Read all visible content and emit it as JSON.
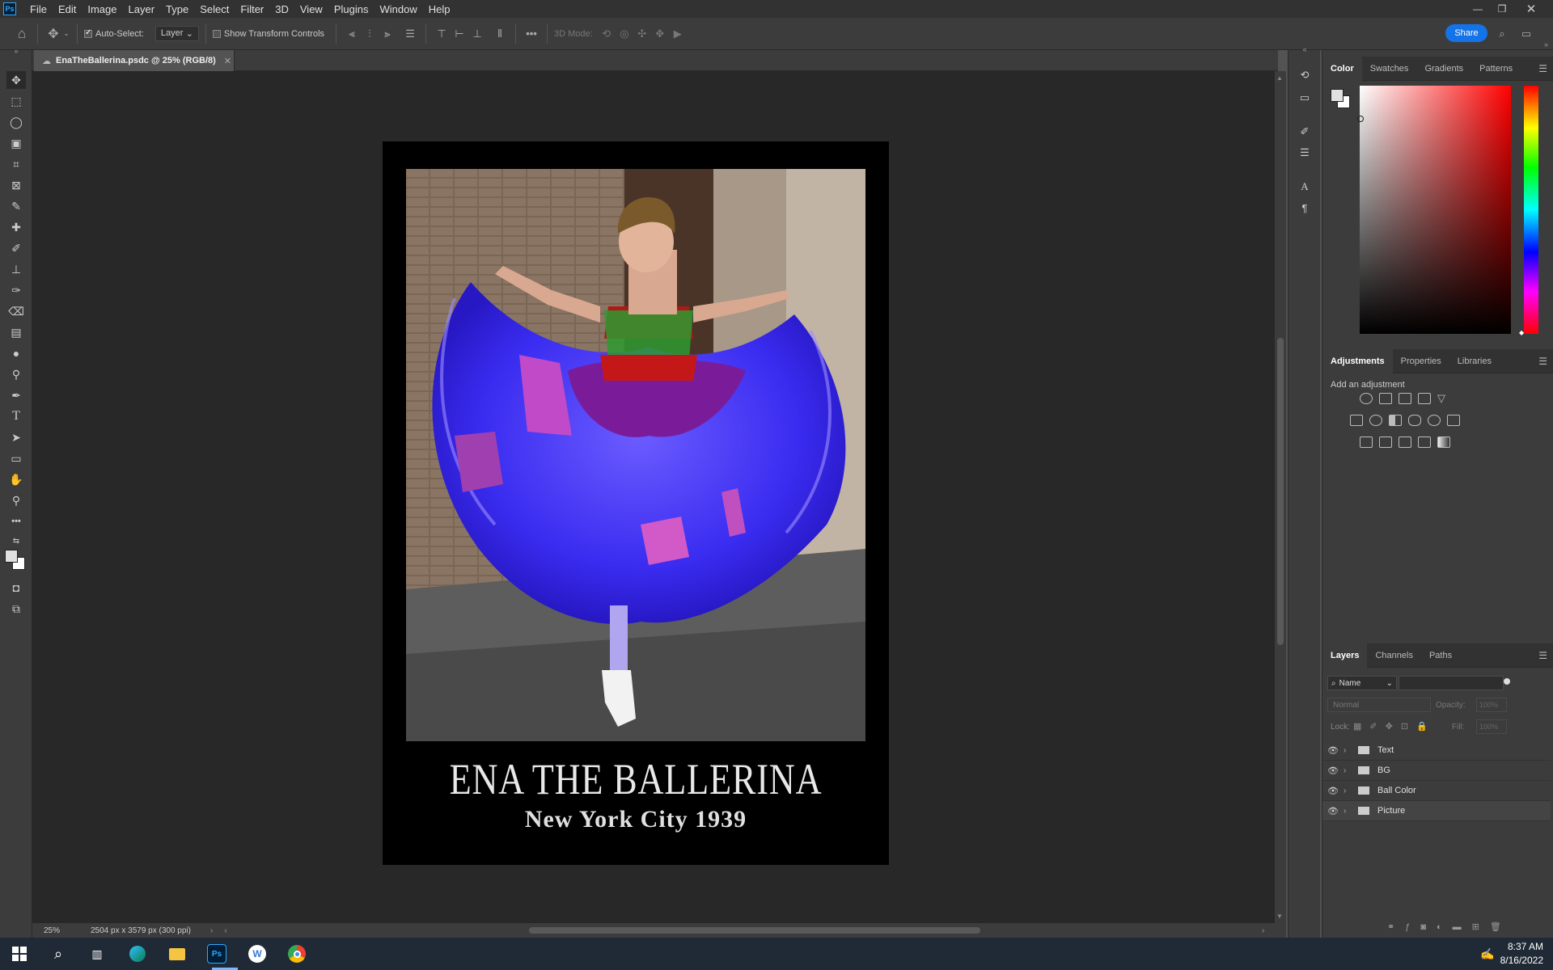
{
  "menubar": {
    "logo": "Ps",
    "items": [
      "File",
      "Edit",
      "Image",
      "Layer",
      "Type",
      "Select",
      "Filter",
      "3D",
      "View",
      "Plugins",
      "Window",
      "Help"
    ]
  },
  "options": {
    "auto_select_label": "Auto-Select:",
    "auto_select_value": "Layer",
    "show_transform_label": "Show Transform Controls",
    "mode_3d_label": "3D Mode:",
    "share_label": "Share"
  },
  "document": {
    "tab_title": "EnaTheBallerina.psdc @ 25% (RGB/8)",
    "zoom": "25%",
    "dimensions": "2504 px x 3579 px (300 ppi)",
    "poster_title": "ENA THE BALLERINA",
    "poster_subtitle": "New York City 1939"
  },
  "color_panel": {
    "tabs": [
      "Color",
      "Swatches",
      "Gradients",
      "Patterns"
    ],
    "hue_color": "#ff0000"
  },
  "adjustments_panel": {
    "tabs": [
      "Adjustments",
      "Properties",
      "Libraries"
    ],
    "hint": "Add an adjustment"
  },
  "layers_panel": {
    "tabs": [
      "Layers",
      "Channels",
      "Paths"
    ],
    "filter_kind": "Name",
    "blend_mode": "Normal",
    "opacity_label": "Opacity:",
    "opacity_value": "100%",
    "lock_label": "Lock:",
    "fill_label": "Fill:",
    "fill_value": "100%",
    "layers": [
      {
        "name": "Text"
      },
      {
        "name": "BG"
      },
      {
        "name": "Ball Color"
      },
      {
        "name": "Picture"
      }
    ]
  },
  "taskbar": {
    "time": "8:37 AM",
    "date": "8/16/2022"
  }
}
